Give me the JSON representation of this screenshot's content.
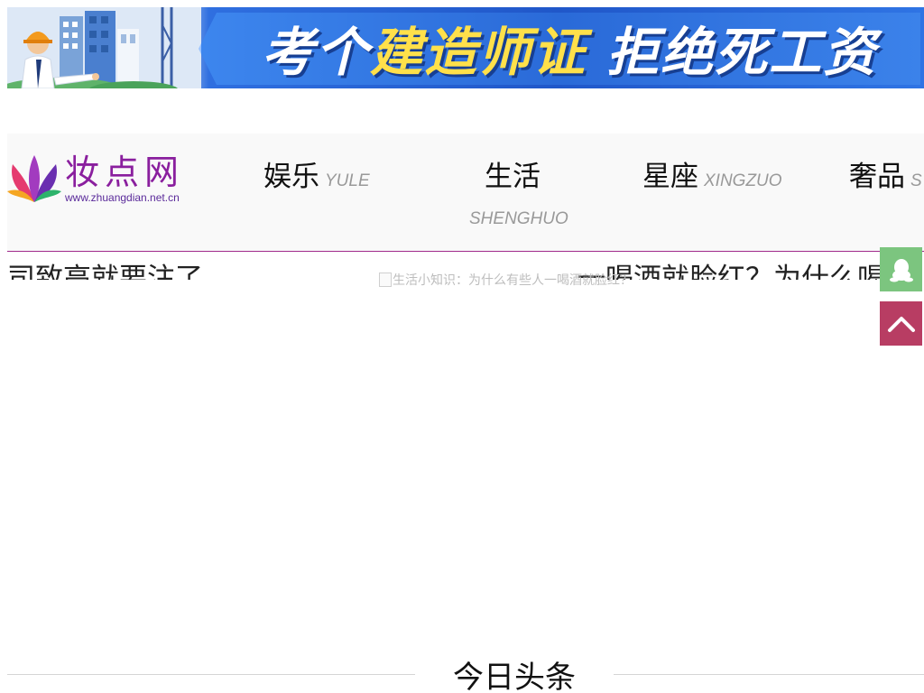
{
  "banner": {
    "slogan_part1": "考个",
    "slogan_highlight": "建造师证",
    "slogan_part2": " 拒绝死工资"
  },
  "logo": {
    "name": "妆点网",
    "url": "www.zhuangdian.net.cn"
  },
  "nav": {
    "items": [
      {
        "zh": "娱乐",
        "en": "YULE"
      },
      {
        "zh": "生活",
        "en": "SHENGHUO"
      },
      {
        "zh": "星座",
        "en": "XINGZUO"
      },
      {
        "zh": "奢品",
        "en": "S"
      }
    ]
  },
  "content": {
    "left_fragment": "司致高就要注了",
    "right_fragment": "一喝酒就脸红？为什么喝",
    "image_alt": "生活小知识：为什么有些人一喝酒就脸红？"
  },
  "float": {
    "qq_icon": "qq-penguin-icon",
    "top_icon": "chevron-up-icon"
  },
  "section": {
    "title": "今日头条"
  },
  "colors": {
    "nav_underline": "#a02a8c",
    "logo_purple": "#8a1f9e",
    "qq_green": "#7cc57f",
    "top_red": "#b83d63",
    "banner_blue": "#2057c9",
    "slogan_yellow": "#ffe04a"
  }
}
